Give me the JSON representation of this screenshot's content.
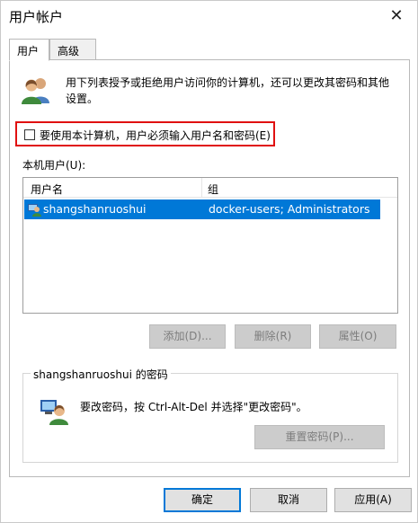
{
  "window": {
    "title": "用户帐户",
    "close_glyph": "✕"
  },
  "tabs": [
    {
      "label": "用户",
      "active": true
    },
    {
      "label": "高级",
      "active": false
    }
  ],
  "users_tab": {
    "intro_icon": "users-icon",
    "intro_text": "用下列表授予或拒绝用户访问你的计算机，还可以更改其密码和其他设置。",
    "require_password_checkbox": {
      "label": "要使用本计算机，用户必须输入用户名和密码(E)",
      "checked": false
    },
    "local_users_label": "本机用户(U):",
    "list": {
      "columns": [
        "用户名",
        "组"
      ],
      "rows": [
        {
          "username": "shangshanruoshui",
          "group": "docker-users; Administrators",
          "selected": true
        }
      ]
    },
    "buttons": {
      "add": "添加(D)...",
      "remove": "删除(R)",
      "properties": "属性(O)"
    },
    "password_group": {
      "title": "shangshanruoshui 的密码",
      "icon": "user-key-icon",
      "text": "要改密码，按 Ctrl-Alt-Del 并选择\"更改密码\"。",
      "reset_button": "重置密码(P)..."
    }
  },
  "footer": {
    "ok": "确定",
    "cancel": "取消",
    "apply": "应用(A)"
  },
  "colors": {
    "selection": "#0078d7",
    "highlight_box": "#e01010"
  }
}
